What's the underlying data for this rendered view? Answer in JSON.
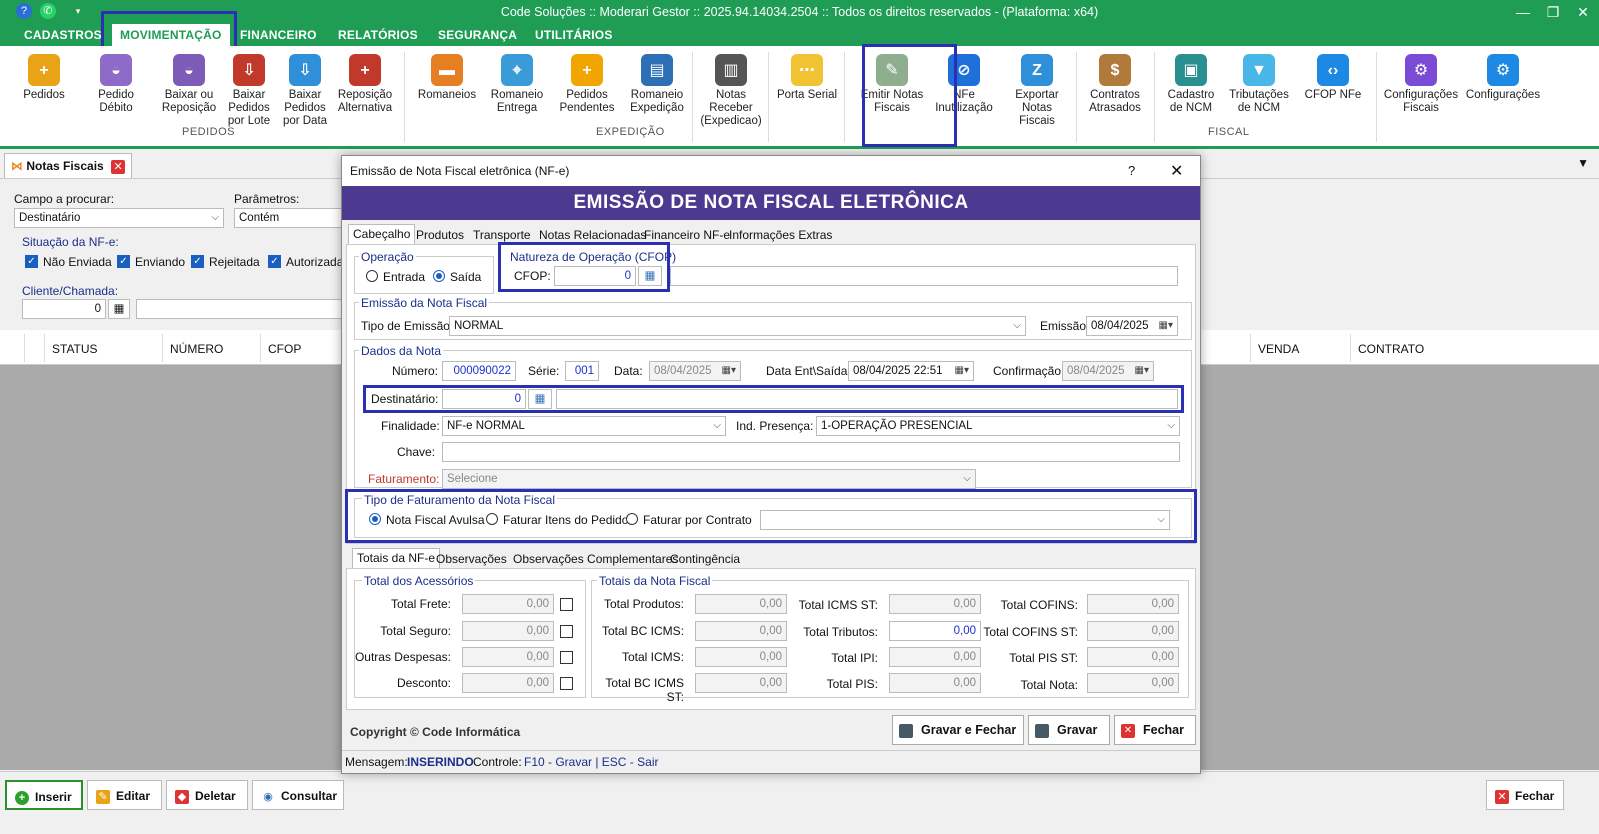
{
  "window": {
    "title": "Code Soluções :: Moderari Gestor :: 2025.94.14034.2504 :: Todos os direitos reservados - (Plataforma: x64)"
  },
  "menu": [
    "CADASTROS",
    "MOVIMENTAÇÃO",
    "FINANCEIRO",
    "RELATÓRIOS",
    "SEGURANÇA",
    "UTILITÁRIOS"
  ],
  "ribbon": {
    "pedidos": {
      "group": "PEDIDOS",
      "items": [
        "Pedidos",
        "Pedido Débito",
        "Baixar ou Reposição",
        "Baixar Pedidos por Lote",
        "Baixar Pedidos por Data",
        "Reposição Alternativa"
      ]
    },
    "expedicao": {
      "group": "EXPEDIÇÃO",
      "items": [
        "Romaneios",
        "Romaneio Entrega",
        "Pedidos Pendentes",
        "Romaneio Expedição",
        "Notas Receber (Expedicao)",
        "Porta Serial"
      ]
    },
    "fiscal": {
      "group": "FISCAL",
      "items": [
        "Emitir Notas Fiscais",
        "NFe Inutilização",
        "Exportar Notas Fiscais",
        "Contratos Atrasados",
        "Cadastro de NCM",
        "Tributações de NCM",
        "CFOP NFe",
        "Configurações Fiscais",
        "Configurações"
      ]
    }
  },
  "doc_tab": "Notas Fiscais",
  "filter": {
    "campo_label": "Campo a procurar:",
    "campo_value": "Destinatário",
    "param_label": "Parâmetros:",
    "param_value": "Contém",
    "situacao_label": "Situação da NF-e:",
    "situacoes": [
      "Não Enviada",
      "Enviando",
      "Rejeitada",
      "Autorizada"
    ],
    "cliente_label": "Cliente/Chamada:",
    "cliente_value": "0"
  },
  "grid": {
    "columns": [
      "STATUS",
      "NÚMERO",
      "CFOP",
      "VENDA",
      "CONTRATO"
    ]
  },
  "bottom": {
    "inserir": "Inserir",
    "editar": "Editar",
    "deletar": "Deletar",
    "consultar": "Consultar",
    "fechar": "Fechar"
  },
  "dialog": {
    "title": "Emissão de Nota Fiscal eletrônica (NF-e)",
    "help": "?",
    "banner": "EMISSÃO DE NOTA FISCAL ELETRÔNICA",
    "tabs": [
      "Cabeçalho",
      "Produtos",
      "Transporte",
      "Notas Relacionadas",
      "Financeiro NF-e",
      "Informações Extras"
    ],
    "operacao": {
      "title": "Operação",
      "entrada": "Entrada",
      "saida": "Saída"
    },
    "natureza": {
      "title": "Natureza de Operação (CFOP)",
      "cfop_label": "CFOP:",
      "cfop_value": "0"
    },
    "emissao": {
      "title": "Emissão da Nota Fiscal",
      "tipo_label": "Tipo de Emissão:",
      "tipo_value": "NORMAL",
      "data_label": "Emissão:",
      "data_value": "08/04/2025"
    },
    "dados": {
      "title": "Dados da Nota",
      "numero_label": "Número:",
      "numero_value": "000090022",
      "serie_label": "Série:",
      "serie_value": "001",
      "data_label": "Data:",
      "data_value": "08/04/2025",
      "entsaida_label": "Data Ent\\Saída:",
      "entsaida_value": "08/04/2025 22:51",
      "confirm_label": "Confirmação:",
      "confirm_value": "08/04/2025",
      "dest_label": "Destinatário:",
      "dest_value": "0",
      "finalidade_label": "Finalidade:",
      "finalidade_value": "NF-e NORMAL",
      "presenca_label": "Ind. Presença:",
      "presenca_value": "1-OPERAÇÃO PRESENCIAL",
      "chave_label": "Chave:",
      "faturamento_label": "Faturamento:",
      "faturamento_value": "Selecione"
    },
    "tipo_fat": {
      "title": "Tipo de Faturamento da Nota Fiscal",
      "avulsa": "Nota Fiscal Avulsa",
      "itens": "Faturar Itens do Pedido",
      "contrato": "Faturar por Contrato"
    },
    "subtabs": [
      "Totais da NF-e",
      "Observações",
      "Observações Complementares",
      "Contingência"
    ],
    "acessorios": {
      "title": "Total dos Acessórios",
      "rows": [
        {
          "label": "Total Frete:",
          "value": "0,00"
        },
        {
          "label": "Total Seguro:",
          "value": "0,00"
        },
        {
          "label": "Outras Despesas:",
          "value": "0,00"
        },
        {
          "label": "Desconto:",
          "value": "0,00"
        }
      ]
    },
    "totais": {
      "title": "Totais da Nota Fiscal",
      "col1": [
        {
          "label": "Total Produtos:",
          "value": "0,00"
        },
        {
          "label": "Total BC ICMS:",
          "value": "0,00"
        },
        {
          "label": "Total ICMS:",
          "value": "0,00"
        },
        {
          "label": "Total BC ICMS ST:",
          "value": "0,00"
        }
      ],
      "col2": [
        {
          "label": "Total ICMS ST:",
          "value": "0,00"
        },
        {
          "label": "Total Tributos:",
          "value": "0,00"
        },
        {
          "label": "Total IPI:",
          "value": "0,00"
        },
        {
          "label": "Total PIS:",
          "value": "0,00"
        }
      ],
      "col3": [
        {
          "label": "Total COFINS:",
          "value": "0,00"
        },
        {
          "label": "Total COFINS ST:",
          "value": "0,00"
        },
        {
          "label": "Total PIS ST:",
          "value": "0,00"
        },
        {
          "label": "Total Nota:",
          "value": "0,00"
        }
      ]
    },
    "copyright": "Copyright © Code Informática",
    "buttons": {
      "gravar_fechar": "Gravar e Fechar",
      "gravar": "Gravar",
      "fechar": "Fechar"
    },
    "status": {
      "msg_label": "Mensagem:",
      "msg_value": "INSERINDO",
      "ctrl_label": "Controle:",
      "ctrl_value": "F10 - Gravar | ESC - Sair"
    }
  },
  "colors": {
    "brand": "#1f9d55",
    "banner": "#4b3a8f",
    "highlight": "#2b2fb3",
    "label_blue": "#1a2f8a"
  }
}
